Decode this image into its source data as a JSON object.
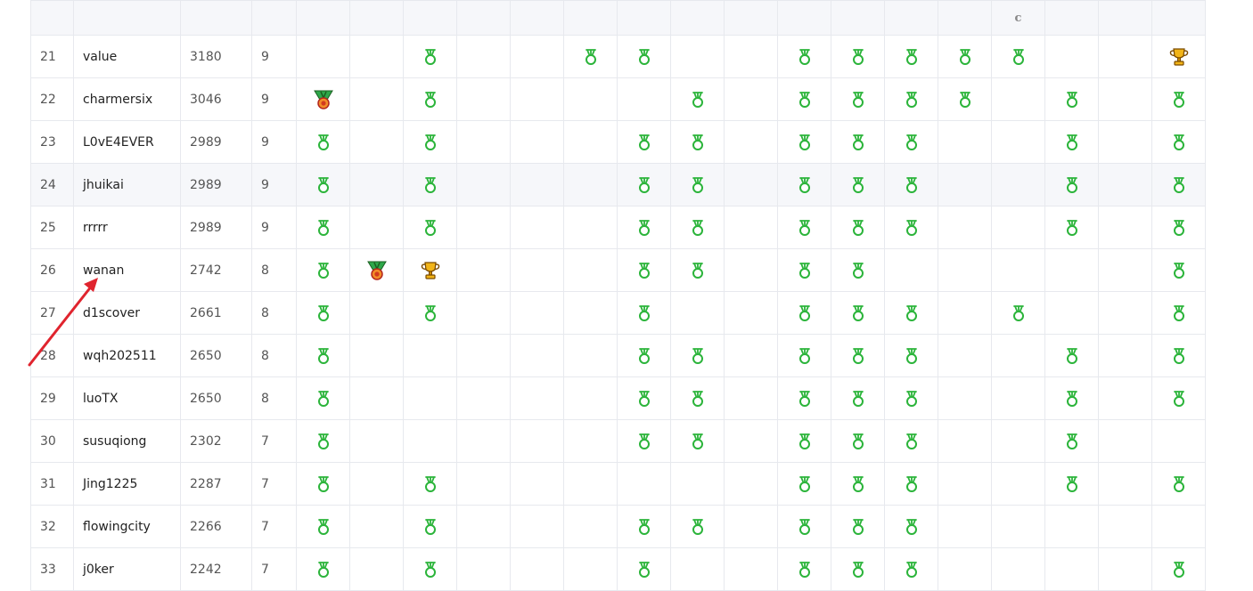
{
  "header": {
    "columns": [
      "",
      "",
      "",
      "",
      "",
      "",
      "",
      "",
      "",
      "",
      "",
      "",
      "",
      "",
      "",
      "",
      "",
      "c",
      "",
      "",
      ""
    ]
  },
  "legend": {
    "solved": "medal-outline-icon",
    "second_blood": "medal-ribbon-icon",
    "first_blood": "trophy-icon"
  },
  "colors": {
    "solved": "#2bb43a",
    "trophy": "#f2b417",
    "ribbon_green": "#2ea84a",
    "ribbon_red": "#d23a1f",
    "arrow": "#e0242e"
  },
  "rows": [
    {
      "rank": "21",
      "name": "value",
      "score": "3180",
      "solved": "9",
      "challenges": [
        "",
        "",
        "s",
        "",
        "",
        "s",
        "s",
        "",
        "",
        "s",
        "s",
        "s",
        "s",
        "s",
        "",
        "",
        "t"
      ]
    },
    {
      "rank": "22",
      "name": "charmersix",
      "score": "3046",
      "solved": "9",
      "challenges": [
        "r",
        "",
        "s",
        "",
        "",
        "",
        "",
        "s",
        "",
        "s",
        "s",
        "s",
        "s",
        "",
        "s",
        "",
        "s"
      ]
    },
    {
      "rank": "23",
      "name": "L0vE4EVER",
      "score": "2989",
      "solved": "9",
      "challenges": [
        "s",
        "",
        "s",
        "",
        "",
        "",
        "s",
        "s",
        "",
        "s",
        "s",
        "s",
        "",
        "",
        "s",
        "",
        "s"
      ]
    },
    {
      "rank": "24",
      "name": "jhuikai",
      "score": "2989",
      "solved": "9",
      "challenges": [
        "s",
        "",
        "s",
        "",
        "",
        "",
        "s",
        "s",
        "",
        "s",
        "s",
        "s",
        "",
        "",
        "s",
        "",
        "s"
      ]
    },
    {
      "rank": "25",
      "name": "rrrrr",
      "score": "2989",
      "solved": "9",
      "challenges": [
        "s",
        "",
        "s",
        "",
        "",
        "",
        "s",
        "s",
        "",
        "s",
        "s",
        "s",
        "",
        "",
        "s",
        "",
        "s"
      ]
    },
    {
      "rank": "26",
      "name": "wanan",
      "score": "2742",
      "solved": "8",
      "challenges": [
        "s",
        "r",
        "t",
        "",
        "",
        "",
        "s",
        "s",
        "",
        "s",
        "s",
        "",
        "",
        "",
        "",
        "",
        "s"
      ]
    },
    {
      "rank": "27",
      "name": "d1scover",
      "score": "2661",
      "solved": "8",
      "challenges": [
        "s",
        "",
        "s",
        "",
        "",
        "",
        "s",
        "",
        "",
        "s",
        "s",
        "s",
        "",
        "s",
        "",
        "",
        "s"
      ]
    },
    {
      "rank": "28",
      "name": "wqh202511",
      "score": "2650",
      "solved": "8",
      "challenges": [
        "s",
        "",
        "",
        "",
        "",
        "",
        "s",
        "s",
        "",
        "s",
        "s",
        "s",
        "",
        "",
        "s",
        "",
        "s"
      ]
    },
    {
      "rank": "29",
      "name": "luoTX",
      "score": "2650",
      "solved": "8",
      "challenges": [
        "s",
        "",
        "",
        "",
        "",
        "",
        "s",
        "s",
        "",
        "s",
        "s",
        "s",
        "",
        "",
        "s",
        "",
        "s"
      ]
    },
    {
      "rank": "30",
      "name": "susuqiong",
      "score": "2302",
      "solved": "7",
      "challenges": [
        "s",
        "",
        "",
        "",
        "",
        "",
        "s",
        "s",
        "",
        "s",
        "s",
        "s",
        "",
        "",
        "s",
        "",
        ""
      ]
    },
    {
      "rank": "31",
      "name": "Jing1225",
      "score": "2287",
      "solved": "7",
      "challenges": [
        "s",
        "",
        "s",
        "",
        "",
        "",
        "",
        "",
        "",
        "s",
        "s",
        "s",
        "",
        "",
        "s",
        "",
        "s"
      ]
    },
    {
      "rank": "32",
      "name": "flowingcity",
      "score": "2266",
      "solved": "7",
      "challenges": [
        "s",
        "",
        "s",
        "",
        "",
        "",
        "s",
        "s",
        "",
        "s",
        "s",
        "s",
        "",
        "",
        "",
        "",
        ""
      ]
    },
    {
      "rank": "33",
      "name": "j0ker",
      "score": "2242",
      "solved": "7",
      "challenges": [
        "s",
        "",
        "s",
        "",
        "",
        "",
        "s",
        "",
        "",
        "s",
        "s",
        "s",
        "",
        "",
        "",
        "",
        "s"
      ]
    }
  ]
}
